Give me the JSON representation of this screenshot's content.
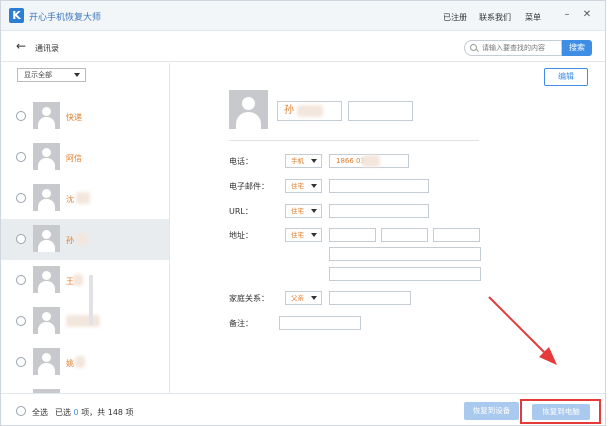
{
  "app": {
    "title": "开心手机恢复大师",
    "logo_letter": "K",
    "registered": "已注册",
    "contact_us": "联系我们",
    "menu": "菜单",
    "minimize": "–",
    "close": "✕"
  },
  "nav": {
    "back": "←",
    "title": "通讯录",
    "search_placeholder": "请输入要查找的内容",
    "search_button": "搜索"
  },
  "sidebar": {
    "filter": "显示全部",
    "contacts": [
      {
        "name": "快递",
        "selected": false
      },
      {
        "name": "阿信",
        "selected": false
      },
      {
        "name": "沈",
        "selected": false
      },
      {
        "name": "孙",
        "selected": true
      },
      {
        "name": "王",
        "selected": false
      },
      {
        "name": "",
        "selected": false
      },
      {
        "name": "姚",
        "selected": false
      }
    ]
  },
  "detail": {
    "edit": "编辑",
    "name": "孙",
    "fields": {
      "phone_label": "电话：",
      "phone_type": "手机",
      "phone_value": "1866      03",
      "email_label": "电子邮件：",
      "email_type": "住宅",
      "url_label": "URL：",
      "url_type": "住宅",
      "address_label": "地址：",
      "address_type": "住宅",
      "family_label": "家庭关系：",
      "family_type": "父亲",
      "note_label": "备注："
    }
  },
  "footer": {
    "select_all": "全选",
    "selected_prefix": "已选",
    "selected_count": "0",
    "selected_suffix": "项，共 148 项",
    "restore_device": "恢复到设备",
    "restore_pc": "恢复到电脑"
  },
  "colors": {
    "accent": "#3e8ee5",
    "name_orange": "#e07b28",
    "highlight_red": "#e53a3a"
  }
}
